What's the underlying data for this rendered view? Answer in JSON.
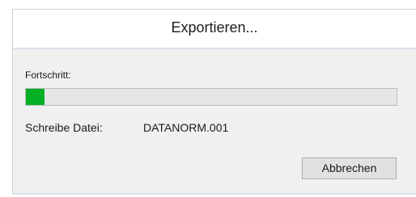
{
  "dialog": {
    "title": "Exportieren...",
    "progress_label": "Fortschritt:",
    "progress_value": 0.05,
    "file_label": "Schreibe Datei:",
    "file_name": "DATANORM.001",
    "cancel_label": "Abbrechen"
  },
  "colors": {
    "progress_fill": "#06b025",
    "progress_track": "#e6e6e6",
    "dialog_background": "#f0f0f0"
  }
}
